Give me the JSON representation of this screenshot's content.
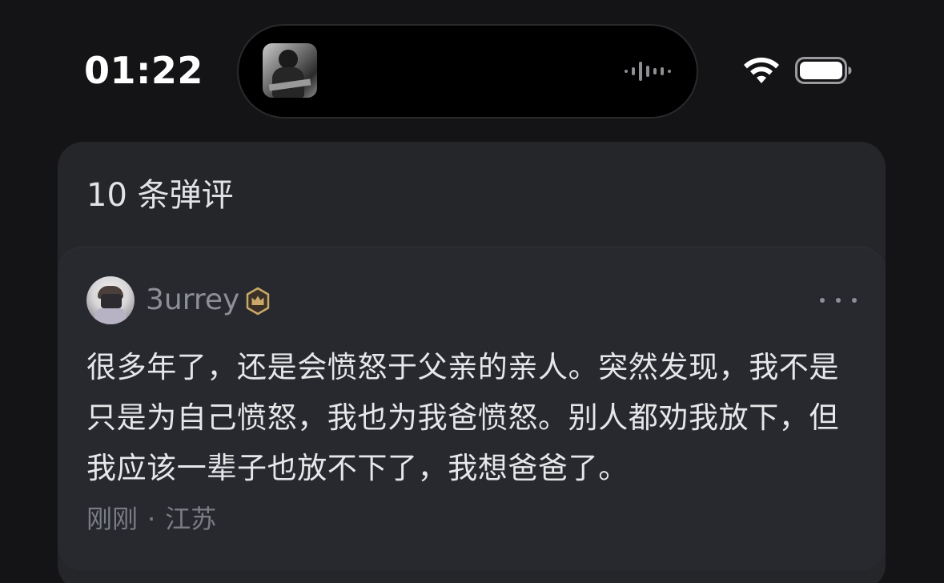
{
  "status_bar": {
    "time": "01:22",
    "now_playing_icon": "album-art",
    "waveform_icon": "audio-waveform-icon",
    "wifi_icon": "wifi-icon",
    "battery_icon": "battery-icon"
  },
  "panel": {
    "title": "10 条弹评",
    "comment": {
      "username": "3urrey",
      "badge_icon": "crown-badge-icon",
      "badge_color": "#c9a86a",
      "more_icon": "more-horizontal-icon",
      "text": "很多年了，还是会愤怒于父亲的亲人。突然发现，我不是只是为自己愤怒，我也为我爸愤怒。别人都劝我放下，但我应该一辈子也放不下了，我想爸爸了。",
      "time": "刚刚",
      "separator": "·",
      "location": "江苏"
    }
  },
  "colors": {
    "background": "#141416",
    "panel": "#24262a",
    "card": "#27292e",
    "text_primary": "#e7e7ea",
    "text_secondary": "#8d8f96"
  }
}
